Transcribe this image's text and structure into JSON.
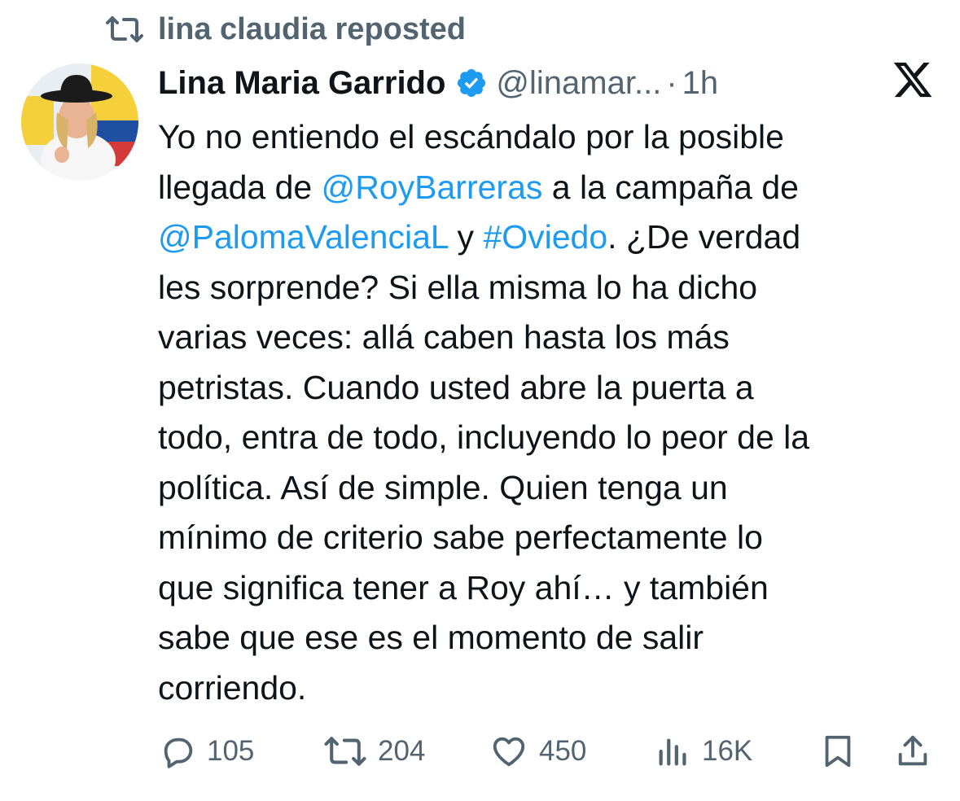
{
  "repost": {
    "label": "lina claudia reposted",
    "icon": "repost-icon"
  },
  "author": {
    "name": "Lina Maria Garrido",
    "verified": true,
    "verified_color": "#1d9bf0",
    "handle": "@linamar...",
    "separator": "·",
    "time": "1h",
    "avatar": "avatar-photo"
  },
  "platform_logo": "x-logo",
  "tweet": {
    "lines": [
      [
        {
          "text": "Yo no entiendo el escándalo por la posible"
        }
      ],
      [
        {
          "text": "llegada de "
        },
        {
          "text": "@RoyBarreras",
          "link": true
        },
        {
          "text": " a la campaña de"
        }
      ],
      [
        {
          "text": "@PalomaValenciaL",
          "link": true
        },
        {
          "text": " y "
        },
        {
          "text": "#Oviedo",
          "link": true
        },
        {
          "text": ". ¿De verdad"
        }
      ],
      [
        {
          "text": "les sorprende? Si ella misma lo ha dicho"
        }
      ],
      [
        {
          "text": "varias veces: allá caben hasta los más"
        }
      ],
      [
        {
          "text": "petristas. Cuando usted abre la puerta a"
        }
      ],
      [
        {
          "text": "todo, entra de todo, incluyendo lo peor de la"
        }
      ],
      [
        {
          "text": "política. Así de simple. Quien tenga un"
        }
      ],
      [
        {
          "text": "mínimo de criterio sabe perfectamente lo"
        }
      ],
      [
        {
          "text": "que significa tener a Roy ahí… y también"
        }
      ],
      [
        {
          "text": "sabe que ese es el momento de salir"
        }
      ],
      [
        {
          "text": "corriendo."
        }
      ]
    ]
  },
  "actions": {
    "replies": "105",
    "reposts": "204",
    "likes": "450",
    "views": "16K"
  },
  "colors": {
    "text": "#0f1419",
    "secondary": "#536471",
    "link": "#1d9bf0"
  }
}
